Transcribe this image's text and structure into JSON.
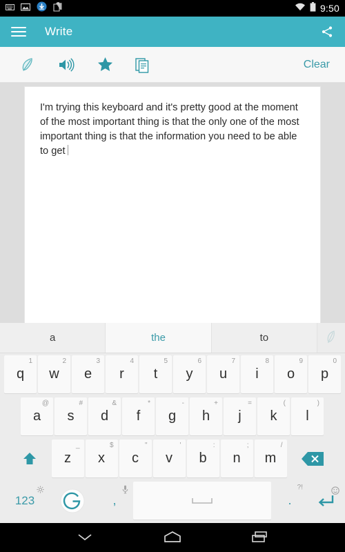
{
  "statusbar": {
    "icons": [
      "keyboard-icon",
      "image-icon",
      "download-icon",
      "clipboard-icon"
    ],
    "wifi": "wifi-icon",
    "battery": "battery-icon",
    "clock": "9:50"
  },
  "appbar": {
    "menu": "hamburger-icon",
    "title": "Write",
    "share": "share-icon",
    "color": "#3fb3c3"
  },
  "toolbar": {
    "icons": [
      {
        "name": "feather-icon",
        "label": "Feather"
      },
      {
        "name": "speaker-icon",
        "label": "Speak"
      },
      {
        "name": "star-icon",
        "label": "Favorite"
      },
      {
        "name": "copy-icon",
        "label": "Copy"
      }
    ],
    "clear_label": "Clear",
    "accent": "#3a9aa8"
  },
  "editor": {
    "text": "I'm trying this keyboard and it's pretty good at the moment of the most important thing is that the only one of the most important thing is that the information you need to be able to get",
    "background": "#dddddd",
    "paper": "#ffffff"
  },
  "keyboard": {
    "suggestions": [
      {
        "label": "a",
        "active": false
      },
      {
        "label": "the",
        "active": true
      },
      {
        "label": "to",
        "active": false
      }
    ],
    "suggest_icon": "feather-icon",
    "row1": [
      {
        "key": "q",
        "sup": "1"
      },
      {
        "key": "w",
        "sup": "2"
      },
      {
        "key": "e",
        "sup": "3"
      },
      {
        "key": "r",
        "sup": "4"
      },
      {
        "key": "t",
        "sup": "5"
      },
      {
        "key": "y",
        "sup": "6"
      },
      {
        "key": "u",
        "sup": "7"
      },
      {
        "key": "i",
        "sup": "8"
      },
      {
        "key": "o",
        "sup": "9"
      },
      {
        "key": "p",
        "sup": "0"
      }
    ],
    "row2": [
      {
        "key": "a",
        "sup": "@"
      },
      {
        "key": "s",
        "sup": "#"
      },
      {
        "key": "d",
        "sup": "&"
      },
      {
        "key": "f",
        "sup": "*"
      },
      {
        "key": "g",
        "sup": "-"
      },
      {
        "key": "h",
        "sup": "+"
      },
      {
        "key": "j",
        "sup": "="
      },
      {
        "key": "k",
        "sup": "("
      },
      {
        "key": "l",
        "sup": ")"
      }
    ],
    "row3": [
      {
        "key": "z",
        "sup": "_"
      },
      {
        "key": "x",
        "sup": "$"
      },
      {
        "key": "c",
        "sup": "\""
      },
      {
        "key": "v",
        "sup": "'"
      },
      {
        "key": "b",
        "sup": ":"
      },
      {
        "key": "n",
        "sup": ";"
      },
      {
        "key": "m",
        "sup": "/"
      }
    ],
    "shift_icon": "shift-icon",
    "backspace_icon": "backspace-icon",
    "row4": {
      "numeric_label": "123",
      "numeric_sup": "gear-icon",
      "google_icon": "google-icon",
      "comma_label": ",",
      "comma_sup": "microphone-icon",
      "space_label": "space-icon",
      "period_label": ".",
      "period_sup": "?!",
      "enter_icon": "enter-icon",
      "enter_sup": "emoji-icon"
    },
    "accent": "#3a9aa8"
  },
  "navbar": {
    "back": "chevron-down-icon",
    "home": "home-icon",
    "recents": "recents-icon"
  }
}
